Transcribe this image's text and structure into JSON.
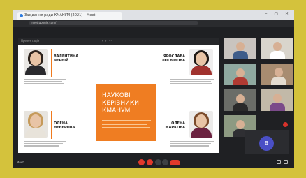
{
  "browser": {
    "tab_title": "Засідання ради КМАНУМ (2021) – Meet",
    "url": "meet.google.com/",
    "window_controls": "–  ▢  ✕"
  },
  "slide_toolbar": {
    "left_text": "Презентація",
    "mid_text": "‹  ›  ⋯"
  },
  "slide": {
    "title_lines": [
      "НАУКОВІ",
      "КЕРІВНИКИ",
      "КМАНУМ"
    ],
    "people": [
      {
        "name_line1": "ВАЛЕНТИНА",
        "name_line2": "ЧЕРНІЙ",
        "hair": "#2c221c",
        "clothes": "#2a2a2e"
      },
      {
        "name_line1": "ЯРОСЛАВА",
        "name_line2": "ЛОГВІНОВА",
        "hair": "#1e1815",
        "clothes": "#a0322e"
      },
      {
        "name_line1": "ОЛЕНА",
        "name_line2": "НЕВЕРОВА",
        "hair": "#c59a5a",
        "clothes": "#e8e3da"
      },
      {
        "name_line1": "ОЛЕНА",
        "name_line2": "МАРКОВА",
        "hair": "#7a4a2a",
        "clothes": "#6b2240"
      }
    ],
    "accent_color": "#ef7d22"
  },
  "gallery": {
    "avatar_letter": "В",
    "avatar_color": "#4a4fc6"
  },
  "controls": {
    "meeting_label": "Meet"
  }
}
